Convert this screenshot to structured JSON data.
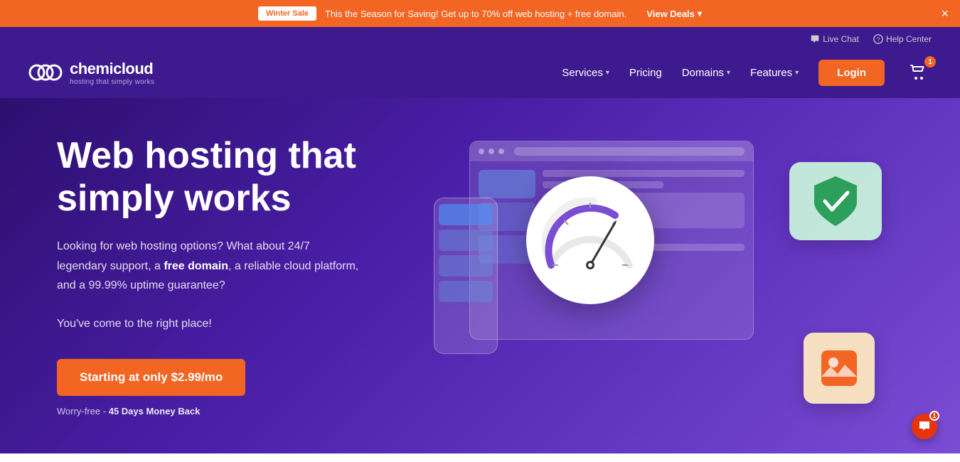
{
  "banner": {
    "badge": "Winter Sale",
    "text": "This the Season for Saving! Get up to 70% off web hosting + free domain.",
    "cta": "View Deals",
    "close": "×",
    "bg_color": "#f26522"
  },
  "header": {
    "util_links": [
      {
        "icon": "chat-icon",
        "label": "Live Chat"
      },
      {
        "icon": "help-icon",
        "label": "Help Center"
      }
    ],
    "logo": {
      "name": "chemicloud",
      "tagline": "hosting that simply works"
    },
    "nav": [
      {
        "label": "Services",
        "has_dropdown": true
      },
      {
        "label": "Pricing",
        "has_dropdown": false
      },
      {
        "label": "Domains",
        "has_dropdown": true
      },
      {
        "label": "Features",
        "has_dropdown": true
      }
    ],
    "login_label": "Login",
    "cart_count": "1"
  },
  "hero": {
    "title": "Web hosting that simply works",
    "description_1": "Looking for web hosting options? What about 24/7 legendary support, a ",
    "description_bold": "free domain",
    "description_2": ", a reliable cloud platform, and a 99.99% uptime guarantee?",
    "description_line2": "You've come to the right place!",
    "cta_label": "Starting at only $2.99/mo",
    "moneyback_prefix": "Worry-free - ",
    "moneyback_bold": "45 Days Money Back",
    "accent_color": "#f26522"
  },
  "chat_widget": {
    "count": "1"
  }
}
